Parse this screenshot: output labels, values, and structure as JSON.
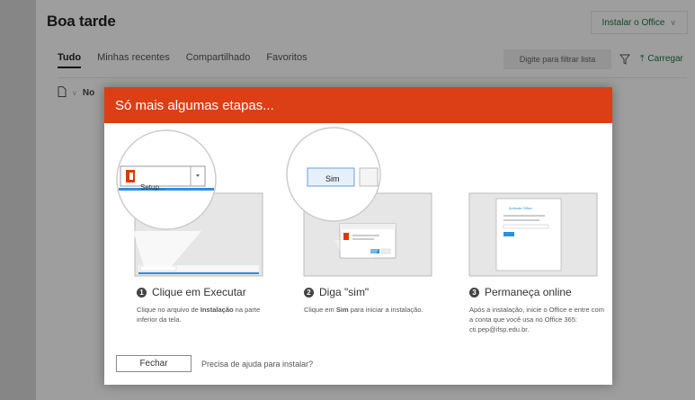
{
  "page": {
    "greeting": "Boa tarde",
    "install_office": "Instalar o Office",
    "tabs": [
      "Tudo",
      "Minhas recentes",
      "Compartilhado",
      "Favoritos"
    ],
    "filter_placeholder": "Digite para filtrar lista",
    "upload_label": "Carregar",
    "list_name_header": "No"
  },
  "dialog": {
    "title": "Só mais algumas etapas...",
    "steps": [
      {
        "number": "1",
        "title": "Clique em Executar",
        "desc_pre": "Clique no arquivo de ",
        "desc_bold": "Instalação",
        "desc_post": " na parte inferior da tela."
      },
      {
        "number": "2",
        "title": "Diga \"sim\"",
        "desc_pre": "Clique em ",
        "desc_bold": "Sim",
        "desc_post": " para iniciar a instalação."
      },
      {
        "number": "3",
        "title": "Permaneça online",
        "desc": "Após a instalação, inicie o Office e entre com a conta que você usa no Office 365: cti.pep@ifsp.edu.br."
      }
    ],
    "setup_label": "Setup...",
    "sim_label": "Sim",
    "activate_office": "Activate Office",
    "close_button": "Fechar",
    "help_link": "Precisa de ajuda para instalar?"
  },
  "colors": {
    "header_orange": "#dc3e15",
    "office_red": "#d83b01",
    "accent_green": "#217346",
    "progress_blue": "#2f8fdd"
  }
}
